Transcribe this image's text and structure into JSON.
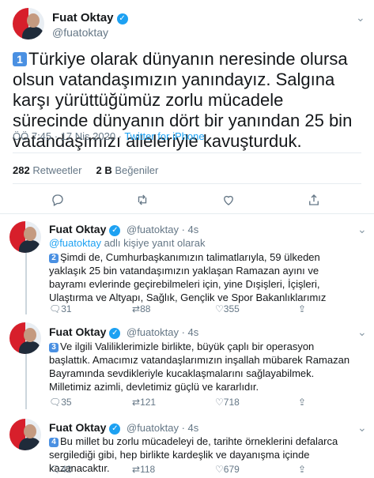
{
  "tweet": {
    "author_name": "Fuat Oktay",
    "author_handle": "@fuatoktay",
    "number": "1",
    "text": "Türkiye olarak dünyanın neresinde olursa olsun vatandaşımızın yanındayız. Salgına karşı yürüttüğümüz zorlu mücadele sürecinde dünyanın dört bir yanından 25 bin vatandaşımızı aileleriyle kavuşturduk.",
    "time": "ÖÖ 7:45 · 17 Nis 2020 · ",
    "source": "Twitter for iPhone",
    "retweets_count": "282",
    "retweets_label": "Retweetler",
    "likes_count": "2 B",
    "likes_label": "Beğeniler"
  },
  "replies": [
    {
      "author_name": "Fuat Oktay",
      "author_handle": "@fuatoktay · 4s",
      "reply_to_handle": "@fuatoktay",
      "reply_to_suffix": " adlı kişiye yanıt olarak",
      "number": "2",
      "text": "Şimdi de, Cumhurbaşkanımızın talimatlarıyla, 59 ülkeden yaklaşık 25 bin vatandaşımızın yaklaşan Ramazan ayını ve bayramı evlerinde geçirebilmeleri için, yine Dışişleri, İçişleri, Ulaştırma ve Altyapı, Sağlık, Gençlik ve Spor Bakanlıklarımız",
      "replies": "31",
      "retweets": "88",
      "likes": "355"
    },
    {
      "author_name": "Fuat Oktay",
      "author_handle": "@fuatoktay · 4s",
      "number": "3",
      "text": "Ve ilgili Valiliklerimizle birlikte, büyük çaplı bir operasyon başlattık. Amacımız vatandaşlarımızın inşallah mübarek Ramazan Bayramında sevdikleriyle kucaklaşmalarını sağlayabilmek. Milletimiz azimli, devletimiz güçlü ve kararlıdır.",
      "replies": "35",
      "retweets": "121",
      "likes": "718"
    },
    {
      "author_name": "Fuat Oktay",
      "author_handle": "@fuatoktay · 4s",
      "number": "4",
      "text": "Bu millet bu zorlu mücadeleyi de, tarihte örneklerini defalarca sergilediği gibi, hep birlikte kardeşlik ve dayanışma içinde kazanacaktır.",
      "replies": "42",
      "retweets": "118",
      "likes": "679"
    }
  ],
  "colors": {
    "link": "#1da1f2",
    "muted": "#657786",
    "badge": "#4a90e2"
  },
  "icons": [
    "verified-icon",
    "chevron-down-icon",
    "reply-icon",
    "retweet-icon",
    "like-icon",
    "share-icon"
  ]
}
